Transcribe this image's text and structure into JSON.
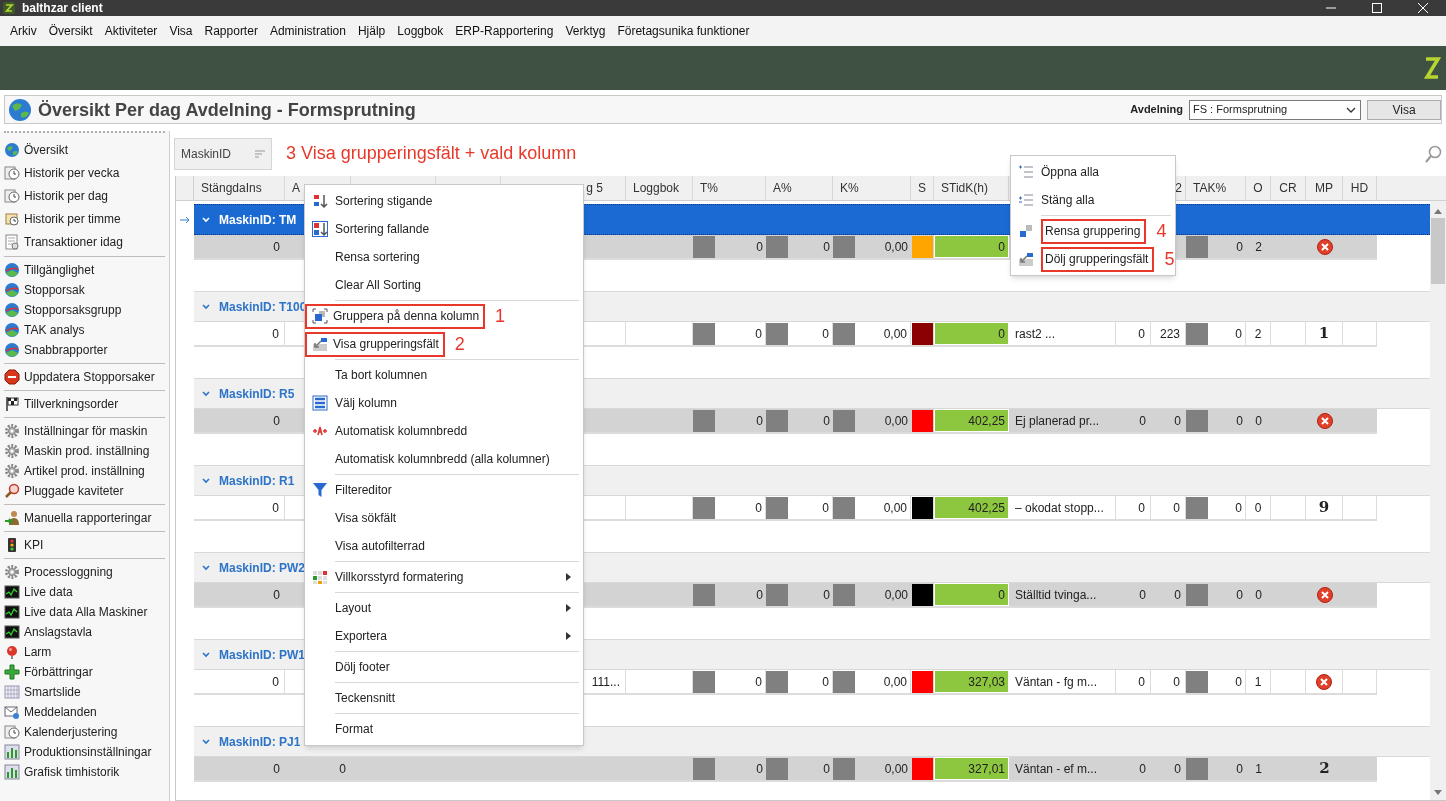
{
  "window": {
    "title": "balthzar client"
  },
  "menu_bar": [
    "Arkiv",
    "Översikt",
    "Aktiviteter",
    "Visa",
    "Rapporter",
    "Administration",
    "Hjälp",
    "Loggbok",
    "ERP-Rapportering",
    "Verktyg",
    "Företagsunika funktioner"
  ],
  "page": {
    "title": "Översikt Per dag Avdelning - Formsprutning",
    "department_label": "Avdelning",
    "department_value": "FS : Formsprutning",
    "show_button": "Visa"
  },
  "sidebar": {
    "sections": [
      {
        "items": [
          {
            "label": "Översikt",
            "kind": "globe"
          },
          {
            "label": "Historik per vecka",
            "kind": "clock"
          },
          {
            "label": "Historik per dag",
            "kind": "clock"
          },
          {
            "label": "Historik per timme",
            "kind": "scroll"
          },
          {
            "label": "Transaktioner idag",
            "kind": "document"
          }
        ]
      },
      {
        "items": [
          {
            "label": "Tillgänglighet",
            "kind": "pie"
          },
          {
            "label": "Stopporsak",
            "kind": "pie"
          },
          {
            "label": "Stopporsaksgrupp",
            "kind": "pie"
          },
          {
            "label": "TAK analys",
            "kind": "pie"
          },
          {
            "label": "Snabbrapporter",
            "kind": "pie"
          }
        ]
      },
      {
        "items": [
          {
            "label": "Uppdatera Stopporsaker",
            "kind": "stop"
          }
        ]
      },
      {
        "items": [
          {
            "label": "Tillverkningsorder",
            "kind": "flag"
          }
        ]
      },
      {
        "items": [
          {
            "label": "Inställningar för maskin",
            "kind": "gear"
          },
          {
            "label": "Maskin prod. inställning",
            "kind": "gear"
          },
          {
            "label": "Artikel prod. inställning",
            "kind": "gear"
          },
          {
            "label": "Pluggade kaviteter",
            "kind": "magnifier"
          }
        ]
      },
      {
        "items": [
          {
            "label": "Manuella rapporteringar",
            "kind": "person"
          }
        ]
      },
      {
        "items": [
          {
            "label": "KPI",
            "kind": "traffic"
          }
        ]
      },
      {
        "items": [
          {
            "label": "Processloggning",
            "kind": "gear"
          },
          {
            "label": "Live data",
            "kind": "monitor"
          },
          {
            "label": "Live data Alla Maskiner",
            "kind": "monitor"
          },
          {
            "label": "Anslagstavla",
            "kind": "monitor"
          },
          {
            "label": "Larm",
            "kind": "bell"
          },
          {
            "label": "Förbättringar",
            "kind": "plus"
          },
          {
            "label": "Smartslide",
            "kind": "grid"
          },
          {
            "label": "Meddelanden",
            "kind": "mail"
          },
          {
            "label": "Kalenderjustering",
            "kind": "clock"
          },
          {
            "label": "Produktionsinställningar",
            "kind": "chart"
          },
          {
            "label": "Grafisk timhistorik",
            "kind": "chart"
          }
        ]
      }
    ]
  },
  "group_panel": {
    "chips": [
      "MaskinID"
    ],
    "annotation": "3 Visa grupperingsfält + vald kolumn"
  },
  "grid": {
    "columns": [
      {
        "label": "StängdaIns"
      },
      {
        "label": "A"
      },
      {},
      {},
      {
        "label": "g 5"
      },
      {
        "label": "Loggbok"
      },
      {
        "label": "T%"
      },
      {
        "label": "A%"
      },
      {
        "label": "K%"
      },
      {
        "label": "S"
      },
      {
        "label": "STidK(h)"
      },
      {},
      {},
      {
        "label": "2"
      },
      {
        "label": "TAK%"
      },
      {
        "label": "O"
      },
      {
        "label": "CR"
      },
      {
        "label": "MP"
      },
      {
        "label": "HD"
      }
    ],
    "groups": [
      {
        "label": "MaskinID: TM",
        "selected": true,
        "expanded": true,
        "row": {
          "stangda": "0",
          "t": "0",
          "a": "0",
          "k": "0,00",
          "color": "#ffa500",
          "stidk": "0",
          "tak": "0",
          "o": "2",
          "mp": {
            "kind": "error"
          }
        }
      },
      {
        "label": "MaskinID: T100",
        "selected": false,
        "expanded": true,
        "row": {
          "stangda": "0",
          "t": "0",
          "a": "0",
          "k": "0,00",
          "color": "#8b0000",
          "stidk": "0",
          "text": "rast2 ...",
          "n1": "0",
          "n2": "223",
          "tak": "0",
          "o": "2",
          "mp": {
            "kind": "number",
            "text": "1"
          }
        }
      },
      {
        "label": "MaskinID: R5",
        "selected": false,
        "expanded": true,
        "row": {
          "stangda": "0",
          "t": "0",
          "a": "0",
          "k": "0,00",
          "color": "#ff0000",
          "stidk": "402,25",
          "text": "Ej planerad pr...",
          "n1": "0",
          "n2": "0",
          "tak": "0",
          "o": "0",
          "mp": {
            "kind": "error"
          }
        }
      },
      {
        "label": "MaskinID: R1",
        "selected": false,
        "expanded": true,
        "row": {
          "stangda": "0",
          "t": "0",
          "a": "0",
          "k": "0,00",
          "color": "#000000",
          "stidk": "402,25",
          "text": "– okodat stopp...",
          "n1": "0",
          "n2": "0",
          "tak": "0",
          "o": "0",
          "mp": {
            "kind": "number",
            "text": "9"
          }
        }
      },
      {
        "label": "MaskinID: PW2",
        "selected": false,
        "expanded": true,
        "row": {
          "stangda": "0",
          "t": "0",
          "a": "0",
          "k": "0,00",
          "color": "#000000",
          "stidk": "0",
          "text": "Ställtid tvinga...",
          "n1": "0",
          "n2": "0",
          "tak": "0",
          "o": "0",
          "mp": {
            "kind": "error"
          }
        }
      },
      {
        "label": "MaskinID: PW1",
        "selected": false,
        "expanded": true,
        "row": {
          "stangda": "0",
          "g5": "111...",
          "t": "0",
          "a": "0",
          "k": "0,00",
          "color": "#ff0000",
          "stidk": "327,03",
          "text": "Väntan - fg m...",
          "n1": "0",
          "n2": "0",
          "tak": "0",
          "o": "1",
          "mp": {
            "kind": "error"
          }
        }
      },
      {
        "label": "MaskinID: PJ1",
        "selected": false,
        "expanded": true,
        "row": {
          "stangda": "0",
          "col_a": "0",
          "t": "0",
          "a": "0",
          "k": "0,00",
          "color": "#ff0000",
          "stidk": "327,01",
          "text": "Väntan - ef m...",
          "n1": "0",
          "n2": "0",
          "tak": "0",
          "o": "1",
          "mp": {
            "kind": "number",
            "text": "2"
          }
        }
      }
    ]
  },
  "column_menu": {
    "items": [
      {
        "label": "Sortering stigande",
        "kind": "sort-asc"
      },
      {
        "label": "Sortering fallande",
        "kind": "sort-desc"
      },
      {
        "label": "Rensa sortering"
      },
      {
        "label": "Clear All Sorting"
      },
      {
        "label": "Gruppera på denna kolumn",
        "kind": "group",
        "separator_before": true,
        "highlight": true,
        "annotation": "1"
      },
      {
        "label": "Visa grupperingsfält",
        "kind": "group-panel",
        "highlight": true,
        "annotation": "2"
      },
      {
        "label": "Ta bort kolumnen",
        "separator_before": true
      },
      {
        "label": "Välj kolumn",
        "kind": "columns"
      },
      {
        "label": "Automatisk kolumnbredd",
        "kind": "autowidth"
      },
      {
        "label": "Automatisk kolumnbredd (alla kolumner)"
      },
      {
        "label": "Filtereditor",
        "kind": "filter",
        "separator_before": true
      },
      {
        "label": "Visa sökfält"
      },
      {
        "label": "Visa autofilterrad"
      },
      {
        "label": "Villkorsstyrd formatering",
        "kind": "conditional",
        "separator_before": true,
        "submenu": true
      },
      {
        "label": "Layout",
        "separator_before": true,
        "submenu": true
      },
      {
        "label": "Exportera",
        "submenu": true
      },
      {
        "label": "Dölj footer",
        "separator_before": true
      },
      {
        "label": "Teckensnitt",
        "separator_before": true
      },
      {
        "label": "Format",
        "separator_before": true
      }
    ]
  },
  "group_menu": {
    "items": [
      {
        "label": "Öppna alla",
        "kind": "expand"
      },
      {
        "label": "Stäng alla",
        "kind": "collapse"
      },
      {
        "label": "Rensa gruppering",
        "kind": "clear-group",
        "separator_before": true,
        "highlight": true,
        "annotation": "4"
      },
      {
        "label": "Dölj grupperingsfält",
        "kind": "group-panel",
        "highlight": true,
        "annotation": "5"
      }
    ]
  }
}
